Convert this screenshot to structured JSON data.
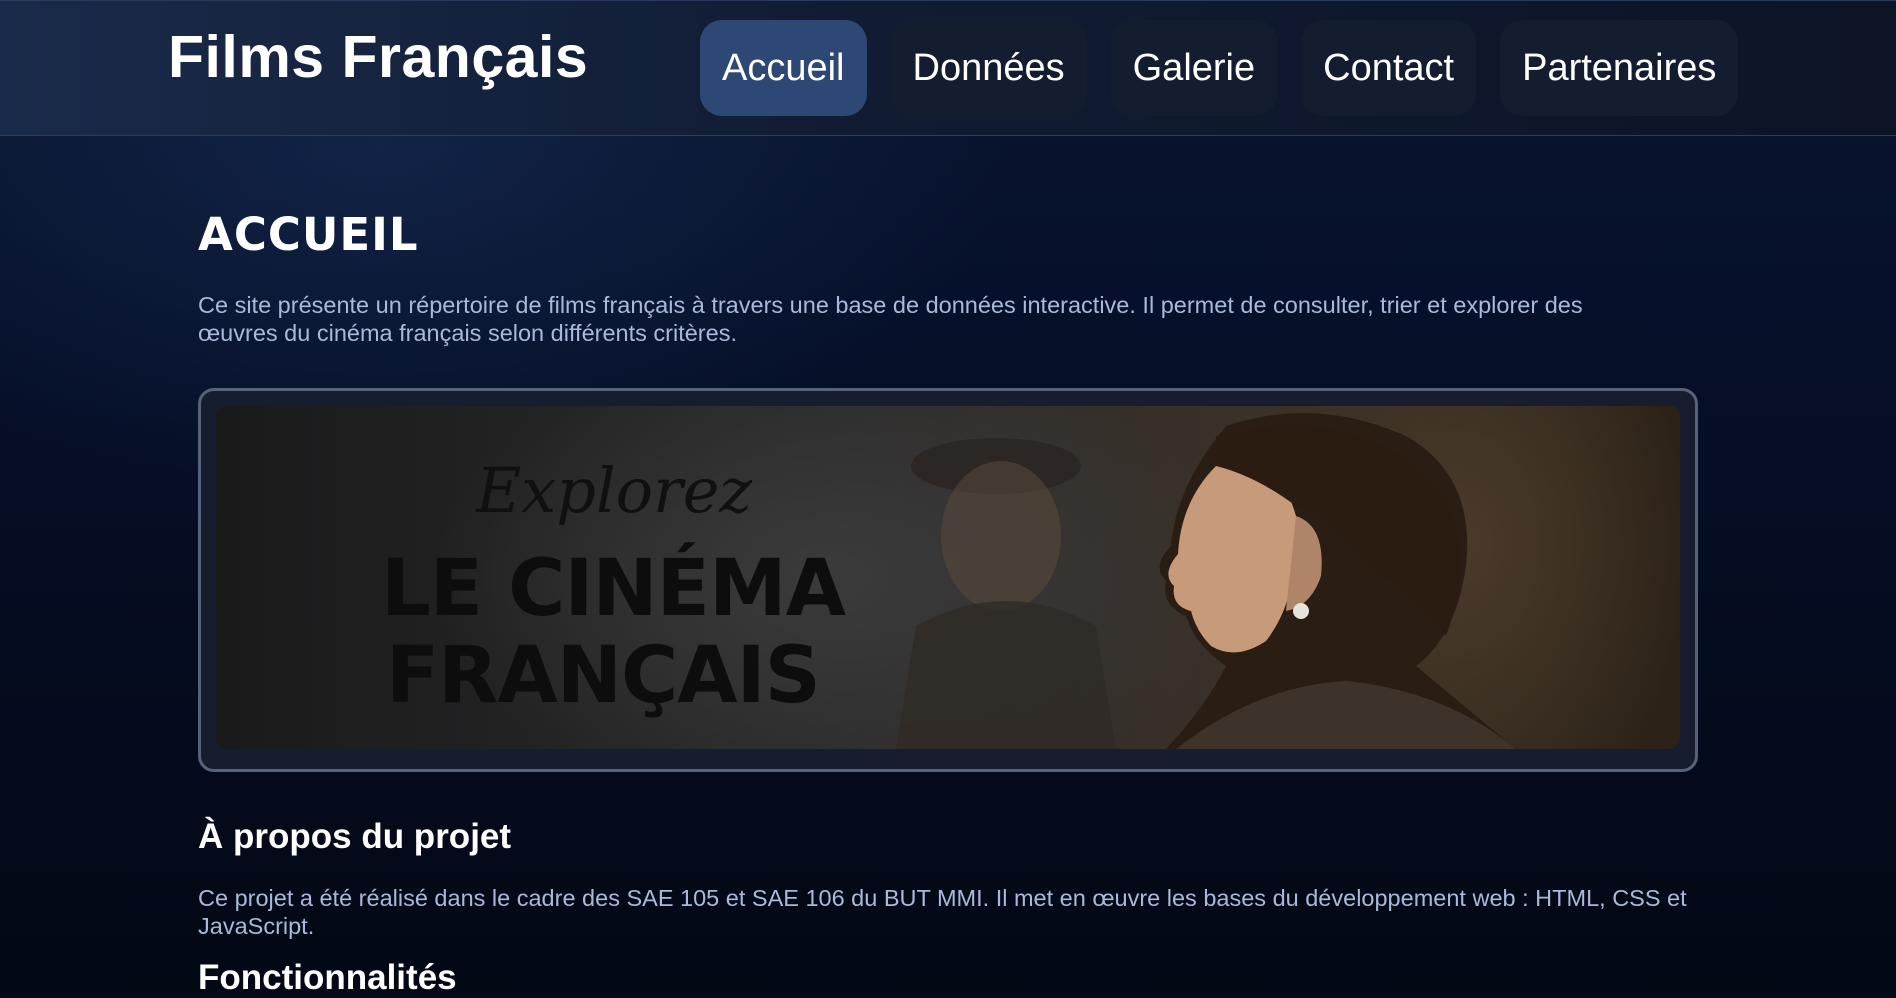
{
  "header": {
    "site_title": "Films Français",
    "nav": [
      {
        "label": "Accueil",
        "active": true
      },
      {
        "label": "Données",
        "active": false
      },
      {
        "label": "Galerie",
        "active": false
      },
      {
        "label": "Contact",
        "active": false
      },
      {
        "label": "Partenaires",
        "active": false
      }
    ]
  },
  "main": {
    "page_title": "ACCUEIL",
    "intro": "Ce site présente un répertoire de films français à travers une base de données interactive. Il permet de consulter, trier et explorer des œuvres du cinéma français selon différents critères.",
    "banner": {
      "script_text": "Explorez",
      "line1": "LE CINÉMA",
      "line2": "FRANÇAIS"
    },
    "about_title": "À propos du projet",
    "about_text": "Ce projet a été réalisé dans le cadre des SAE 105 et SAE 106 du BUT MMI. Il met en œuvre les bases du développement web : HTML, CSS et JavaScript.",
    "features_title": "Fonctionnalités"
  },
  "colors": {
    "background": "#050a18",
    "nav_active": "#2e4876",
    "nav_inactive": "#141d30",
    "body_text": "#aab9d9"
  }
}
